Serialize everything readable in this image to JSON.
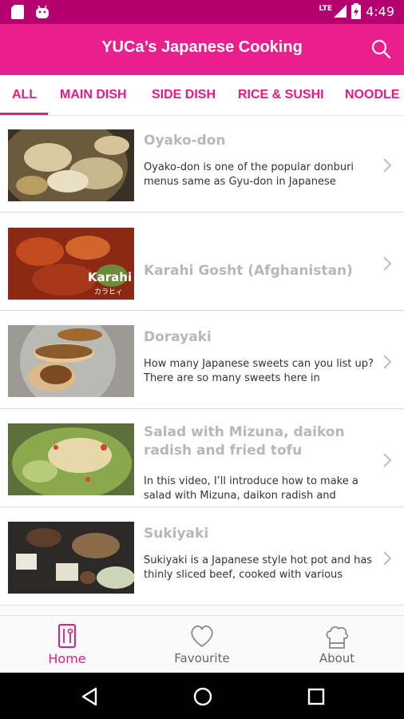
{
  "status_bar": {
    "time": "4:49",
    "network": "LTE"
  },
  "app_bar": {
    "title": "YUCa’s Japanese Cooking"
  },
  "tabs": [
    {
      "label": "ALL"
    },
    {
      "label": "MAIN DISH"
    },
    {
      "label": "SIDE DISH"
    },
    {
      "label": "RICE & SUSHI"
    },
    {
      "label": "NOODLE"
    }
  ],
  "recipes": [
    {
      "title": "Oyako-don",
      "description": "Oyako-don is one of the popular donburi menus same as Gyu-don in Japanese"
    },
    {
      "title": "Karahi Gosht (Afghanistan)",
      "description": "",
      "thumb_caption": "Karahi",
      "thumb_subcaption": "カラヒィ"
    },
    {
      "title": "Dorayaki",
      "description": "How many Japanese sweets can you list up? There are so many sweets here in"
    },
    {
      "title": "Salad with Mizuna, daikon radish and fried tofu",
      "description": "In this video, I’ll introduce how to make a salad with Mizuna, daikon radish and"
    },
    {
      "title": "Sukiyaki",
      "description": "Sukiyaki is a Japanese style hot pot and has thinly sliced beef, cooked with various"
    }
  ],
  "bottom_nav": {
    "home": "Home",
    "favourite": "Favourite",
    "about": "About"
  },
  "colors": {
    "primary": "#ea1e8c",
    "status_bar": "#b5006f",
    "accent": "#e31c85"
  }
}
